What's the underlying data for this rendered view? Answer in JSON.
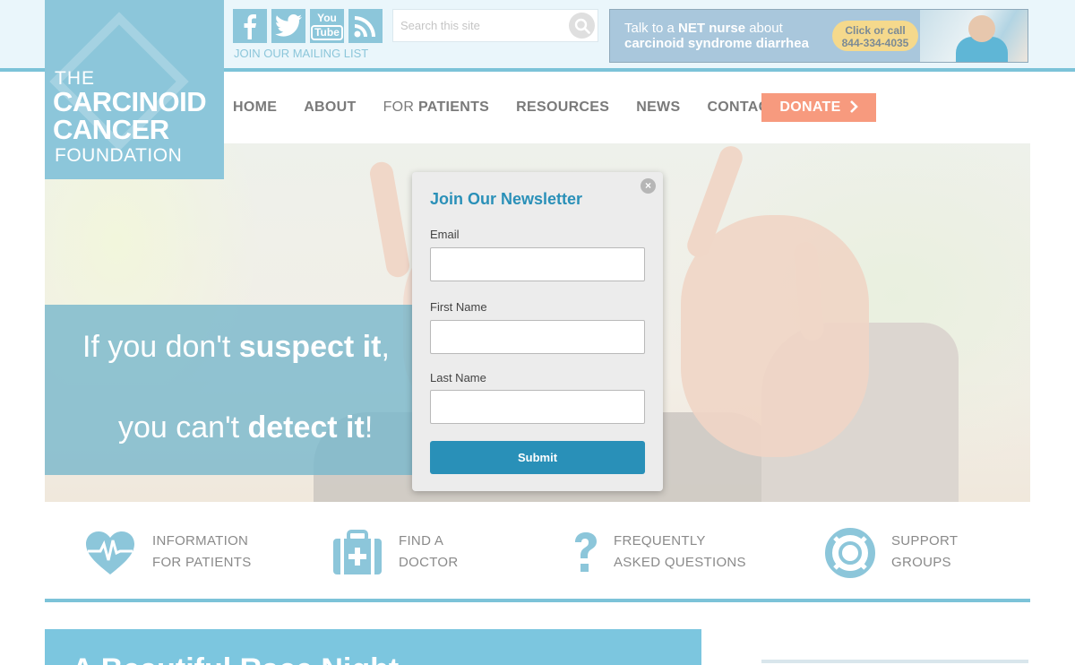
{
  "logo": {
    "line1": "THE",
    "line2": "CARCINOID",
    "line3": "CANCER",
    "line4": "FOUNDATION"
  },
  "social": {
    "facebook": "facebook-icon",
    "twitter": "twitter-icon",
    "youtube_line1": "You",
    "youtube_line2": "Tube",
    "rss": "rss-icon",
    "mailing_label": "JOIN OUR MAILING LIST"
  },
  "search": {
    "placeholder": "Search this site"
  },
  "ad": {
    "line1_prefix": "Talk to a ",
    "line1_bold": "NET nurse",
    "line1_suffix": " about",
    "line2": "carcinoid syndrome diarrhea",
    "badge_line1": "Click or call",
    "badge_line2": "844-334-4035"
  },
  "nav": {
    "home": "HOME",
    "about": "ABOUT",
    "for_prefix": "FOR ",
    "patients": "PATIENTS",
    "resources": "RESOURCES",
    "news": "NEWS",
    "contact": "CONTACT",
    "donate": "DONATE"
  },
  "hero": {
    "line1_prefix": "If you don't ",
    "line1_bold": "suspect it",
    "line1_suffix": ",",
    "line2_prefix": "you can't ",
    "line2_bold": "detect it",
    "line2_suffix": "!"
  },
  "newsletter": {
    "title": "Join Our Newsletter",
    "close": "×",
    "email_label": "Email",
    "first_name_label": "First Name",
    "last_name_label": "Last Name",
    "submit": "Submit"
  },
  "features": [
    {
      "icon": "heartbeat-icon",
      "line1": "INFORMATION",
      "line2": "FOR PATIENTS"
    },
    {
      "icon": "medical-kit-icon",
      "line1": "FIND A",
      "line2": "DOCTOR"
    },
    {
      "icon": "question-mark-icon",
      "line1": "FREQUENTLY",
      "line2": "ASKED QUESTIONS"
    },
    {
      "icon": "life-ring-icon",
      "line1": "SUPPORT",
      "line2": "GROUPS"
    }
  ],
  "bottom": {
    "heading": "A Beautiful Race Night"
  },
  "colors": {
    "brand_blue": "#8cc6da",
    "accent_blue": "#2990b8",
    "donate_coral": "#f79a7e"
  }
}
